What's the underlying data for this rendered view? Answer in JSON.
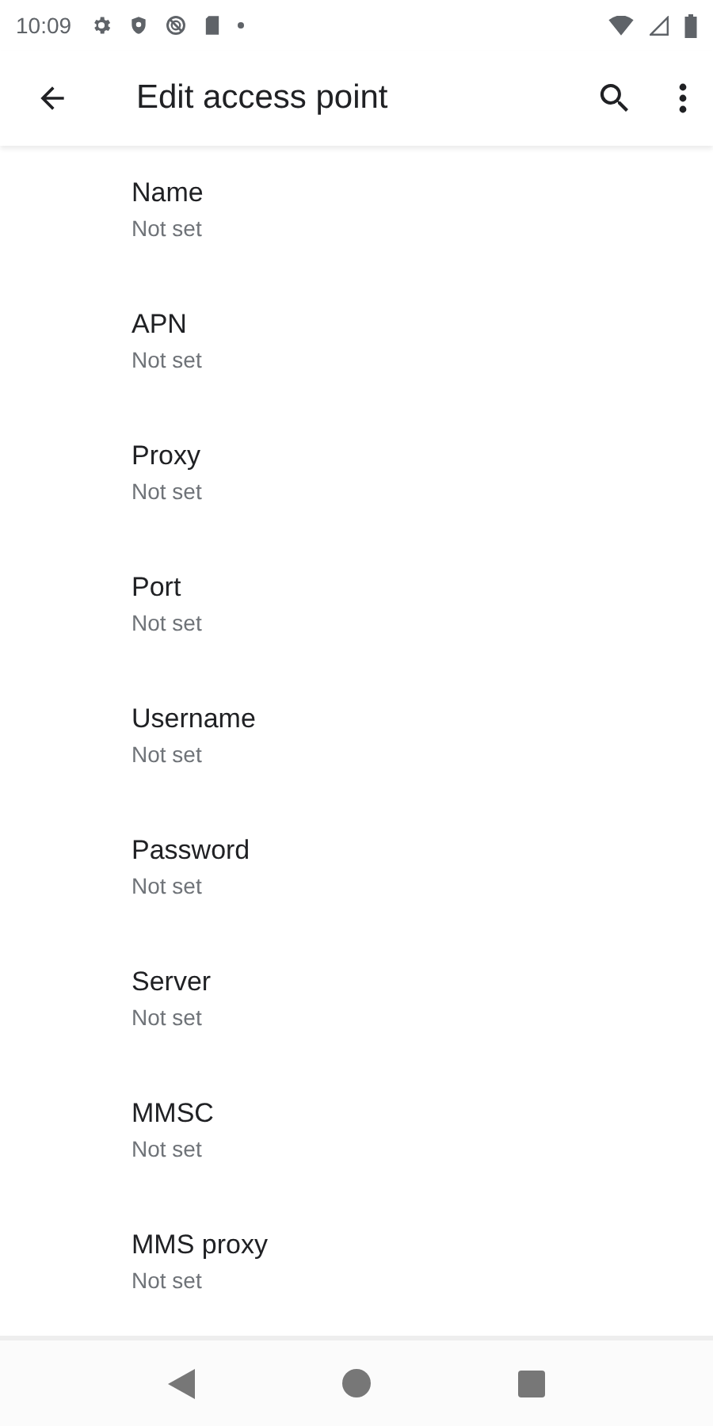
{
  "status_bar": {
    "time": "10:09"
  },
  "app_bar": {
    "title": "Edit access point"
  },
  "items": [
    {
      "title": "Name",
      "summary": "Not set"
    },
    {
      "title": "APN",
      "summary": "Not set"
    },
    {
      "title": "Proxy",
      "summary": "Not set"
    },
    {
      "title": "Port",
      "summary": "Not set"
    },
    {
      "title": "Username",
      "summary": "Not set"
    },
    {
      "title": "Password",
      "summary": "Not set"
    },
    {
      "title": "Server",
      "summary": "Not set"
    },
    {
      "title": "MMSC",
      "summary": "Not set"
    },
    {
      "title": "MMS proxy",
      "summary": "Not set"
    }
  ]
}
